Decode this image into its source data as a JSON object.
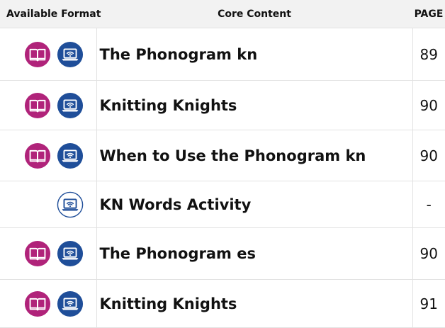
{
  "header": {
    "format_label": "Available Format",
    "core_label": "Core Content",
    "page_label": "PAGE"
  },
  "icons": {
    "book": "book-icon",
    "laptop": "laptop-wifi-icon",
    "book_color": "#b0237a",
    "laptop_color": "#1f4e99"
  },
  "rows": [
    {
      "formats": [
        "book",
        "laptop"
      ],
      "title": "The Phonogram kn",
      "page": "89"
    },
    {
      "formats": [
        "book",
        "laptop"
      ],
      "title": "Knitting Knights",
      "page": "90"
    },
    {
      "formats": [
        "book",
        "laptop"
      ],
      "title": "When to Use the Phonogram kn",
      "page": "90"
    },
    {
      "formats": [
        "laptop-outline"
      ],
      "title": "KN Words Activity",
      "page": "-"
    },
    {
      "formats": [
        "book",
        "laptop"
      ],
      "title": "The Phonogram es",
      "page": "90"
    },
    {
      "formats": [
        "book",
        "laptop"
      ],
      "title": "Knitting Knights",
      "page": "91"
    }
  ]
}
